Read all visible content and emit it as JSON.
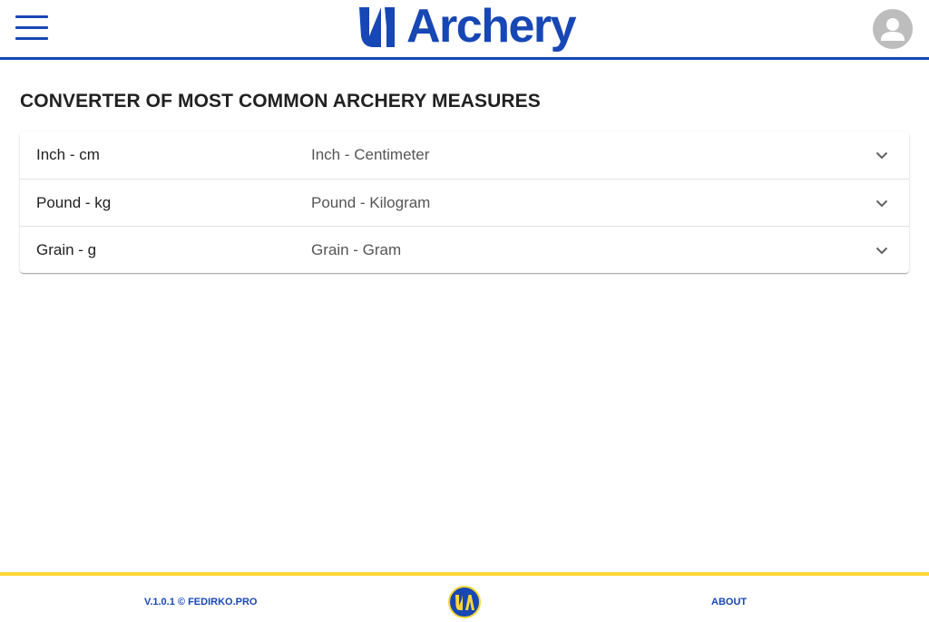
{
  "header": {
    "brand_text": "Archery",
    "brand_color": "#1747b5",
    "menu_icon": "hamburger-menu-icon",
    "avatar_icon": "account-avatar-icon"
  },
  "page": {
    "title": "CONVERTER OF MOST COMMON ARCHERY MEASURES"
  },
  "converters": [
    {
      "label": "Inch - cm",
      "description": "Inch - Centimeter",
      "icon": "chevron-down-icon"
    },
    {
      "label": "Pound - kg",
      "description": "Pound - Kilogram",
      "icon": "chevron-down-icon"
    },
    {
      "label": "Grain - g",
      "description": "Grain - Gram",
      "icon": "chevron-down-icon"
    }
  ],
  "footer": {
    "version": "V.1.0.1 © FEDIRKO.PRO",
    "about": "ABOUT",
    "accent_color": "#fdd835"
  }
}
